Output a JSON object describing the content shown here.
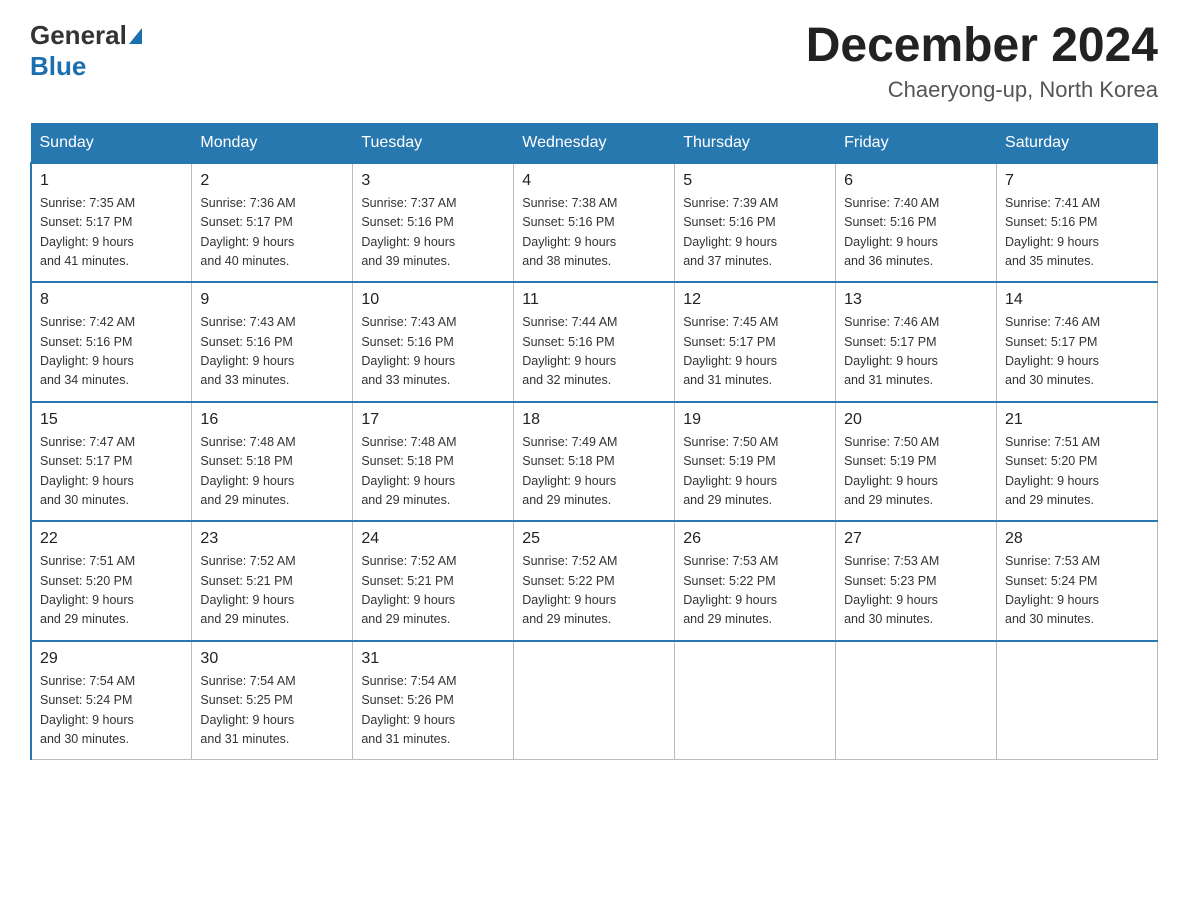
{
  "header": {
    "logo_general": "General",
    "logo_blue": "Blue",
    "title": "December 2024",
    "subtitle": "Chaeryong-up, North Korea"
  },
  "days_of_week": [
    "Sunday",
    "Monday",
    "Tuesday",
    "Wednesday",
    "Thursday",
    "Friday",
    "Saturday"
  ],
  "weeks": [
    [
      {
        "day": "1",
        "sunrise": "7:35 AM",
        "sunset": "5:17 PM",
        "daylight": "9 hours and 41 minutes."
      },
      {
        "day": "2",
        "sunrise": "7:36 AM",
        "sunset": "5:17 PM",
        "daylight": "9 hours and 40 minutes."
      },
      {
        "day": "3",
        "sunrise": "7:37 AM",
        "sunset": "5:16 PM",
        "daylight": "9 hours and 39 minutes."
      },
      {
        "day": "4",
        "sunrise": "7:38 AM",
        "sunset": "5:16 PM",
        "daylight": "9 hours and 38 minutes."
      },
      {
        "day": "5",
        "sunrise": "7:39 AM",
        "sunset": "5:16 PM",
        "daylight": "9 hours and 37 minutes."
      },
      {
        "day": "6",
        "sunrise": "7:40 AM",
        "sunset": "5:16 PM",
        "daylight": "9 hours and 36 minutes."
      },
      {
        "day": "7",
        "sunrise": "7:41 AM",
        "sunset": "5:16 PM",
        "daylight": "9 hours and 35 minutes."
      }
    ],
    [
      {
        "day": "8",
        "sunrise": "7:42 AM",
        "sunset": "5:16 PM",
        "daylight": "9 hours and 34 minutes."
      },
      {
        "day": "9",
        "sunrise": "7:43 AM",
        "sunset": "5:16 PM",
        "daylight": "9 hours and 33 minutes."
      },
      {
        "day": "10",
        "sunrise": "7:43 AM",
        "sunset": "5:16 PM",
        "daylight": "9 hours and 33 minutes."
      },
      {
        "day": "11",
        "sunrise": "7:44 AM",
        "sunset": "5:16 PM",
        "daylight": "9 hours and 32 minutes."
      },
      {
        "day": "12",
        "sunrise": "7:45 AM",
        "sunset": "5:17 PM",
        "daylight": "9 hours and 31 minutes."
      },
      {
        "day": "13",
        "sunrise": "7:46 AM",
        "sunset": "5:17 PM",
        "daylight": "9 hours and 31 minutes."
      },
      {
        "day": "14",
        "sunrise": "7:46 AM",
        "sunset": "5:17 PM",
        "daylight": "9 hours and 30 minutes."
      }
    ],
    [
      {
        "day": "15",
        "sunrise": "7:47 AM",
        "sunset": "5:17 PM",
        "daylight": "9 hours and 30 minutes."
      },
      {
        "day": "16",
        "sunrise": "7:48 AM",
        "sunset": "5:18 PM",
        "daylight": "9 hours and 29 minutes."
      },
      {
        "day": "17",
        "sunrise": "7:48 AM",
        "sunset": "5:18 PM",
        "daylight": "9 hours and 29 minutes."
      },
      {
        "day": "18",
        "sunrise": "7:49 AM",
        "sunset": "5:18 PM",
        "daylight": "9 hours and 29 minutes."
      },
      {
        "day": "19",
        "sunrise": "7:50 AM",
        "sunset": "5:19 PM",
        "daylight": "9 hours and 29 minutes."
      },
      {
        "day": "20",
        "sunrise": "7:50 AM",
        "sunset": "5:19 PM",
        "daylight": "9 hours and 29 minutes."
      },
      {
        "day": "21",
        "sunrise": "7:51 AM",
        "sunset": "5:20 PM",
        "daylight": "9 hours and 29 minutes."
      }
    ],
    [
      {
        "day": "22",
        "sunrise": "7:51 AM",
        "sunset": "5:20 PM",
        "daylight": "9 hours and 29 minutes."
      },
      {
        "day": "23",
        "sunrise": "7:52 AM",
        "sunset": "5:21 PM",
        "daylight": "9 hours and 29 minutes."
      },
      {
        "day": "24",
        "sunrise": "7:52 AM",
        "sunset": "5:21 PM",
        "daylight": "9 hours and 29 minutes."
      },
      {
        "day": "25",
        "sunrise": "7:52 AM",
        "sunset": "5:22 PM",
        "daylight": "9 hours and 29 minutes."
      },
      {
        "day": "26",
        "sunrise": "7:53 AM",
        "sunset": "5:22 PM",
        "daylight": "9 hours and 29 minutes."
      },
      {
        "day": "27",
        "sunrise": "7:53 AM",
        "sunset": "5:23 PM",
        "daylight": "9 hours and 30 minutes."
      },
      {
        "day": "28",
        "sunrise": "7:53 AM",
        "sunset": "5:24 PM",
        "daylight": "9 hours and 30 minutes."
      }
    ],
    [
      {
        "day": "29",
        "sunrise": "7:54 AM",
        "sunset": "5:24 PM",
        "daylight": "9 hours and 30 minutes."
      },
      {
        "day": "30",
        "sunrise": "7:54 AM",
        "sunset": "5:25 PM",
        "daylight": "9 hours and 31 minutes."
      },
      {
        "day": "31",
        "sunrise": "7:54 AM",
        "sunset": "5:26 PM",
        "daylight": "9 hours and 31 minutes."
      },
      null,
      null,
      null,
      null
    ]
  ],
  "labels": {
    "sunrise": "Sunrise:",
    "sunset": "Sunset:",
    "daylight": "Daylight:"
  }
}
